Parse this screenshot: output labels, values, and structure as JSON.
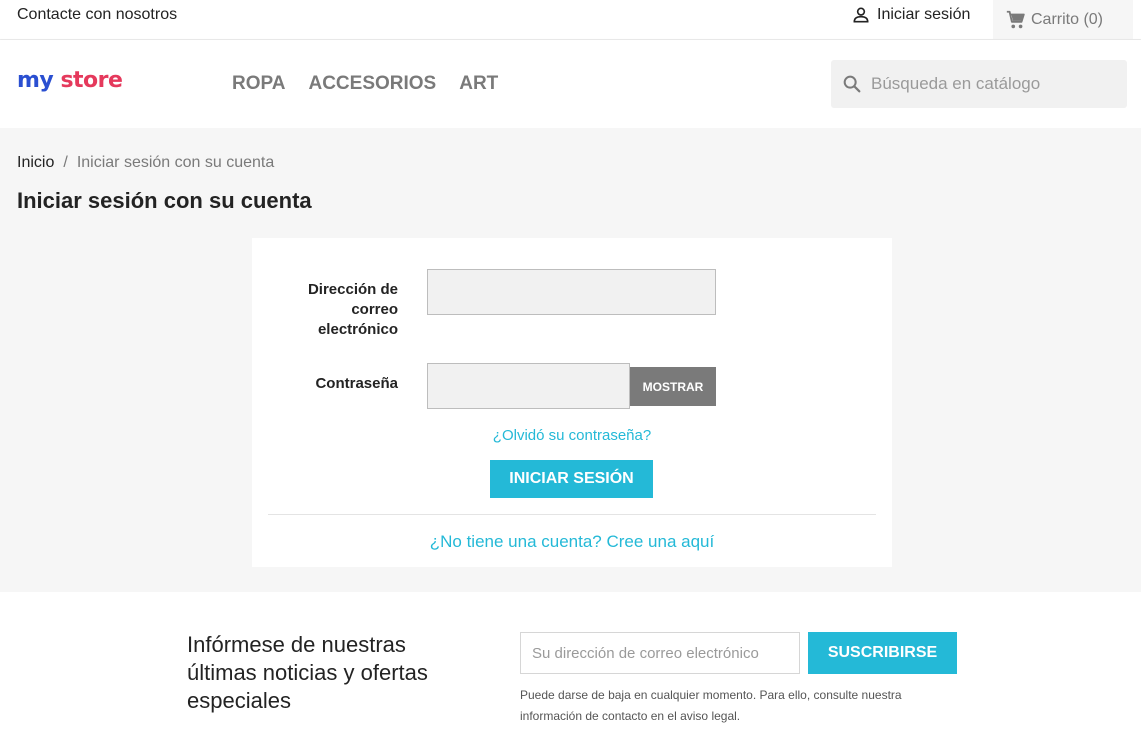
{
  "topbar": {
    "contact": "Contacte con nosotros",
    "signin": "Iniciar sesión",
    "cart": "Carrito (0)"
  },
  "header": {
    "logo": {
      "part1": "my",
      "part2": "store"
    },
    "nav": [
      "ROPA",
      "ACCESORIOS",
      "ART"
    ],
    "search_placeholder": "Búsqueda en catálogo"
  },
  "breadcrumb": {
    "home": "Inicio",
    "separator": "/",
    "current": "Iniciar sesión con su cuenta"
  },
  "page_title": "Iniciar sesión con su cuenta",
  "login_form": {
    "email_label": "Dirección de correo electrónico",
    "email_value": "",
    "password_label": "Contraseña",
    "password_value": "",
    "show_button": "MOSTRAR",
    "forgot_link": "¿Olvidó su contraseña?",
    "submit_button": "INICIAR SESIÓN",
    "no_account_link": "¿No tiene una cuenta? Cree una aquí"
  },
  "newsletter": {
    "title": "Infórmese de nuestras últimas noticias y ofertas especiales",
    "input_placeholder": "Su dirección de correo electrónico",
    "button": "SUSCRIBIRSE",
    "note": "Puede darse de baja en cualquier momento. Para ello, consulte nuestra información de contacto en el aviso legal."
  },
  "colors": {
    "accent": "#24b9d7",
    "muted": "#7a7a7a",
    "text": "#232323",
    "background": "#f6f6f6"
  },
  "icons": {
    "user": "user-icon",
    "cart": "shopping-cart-icon",
    "search": "search-icon"
  }
}
